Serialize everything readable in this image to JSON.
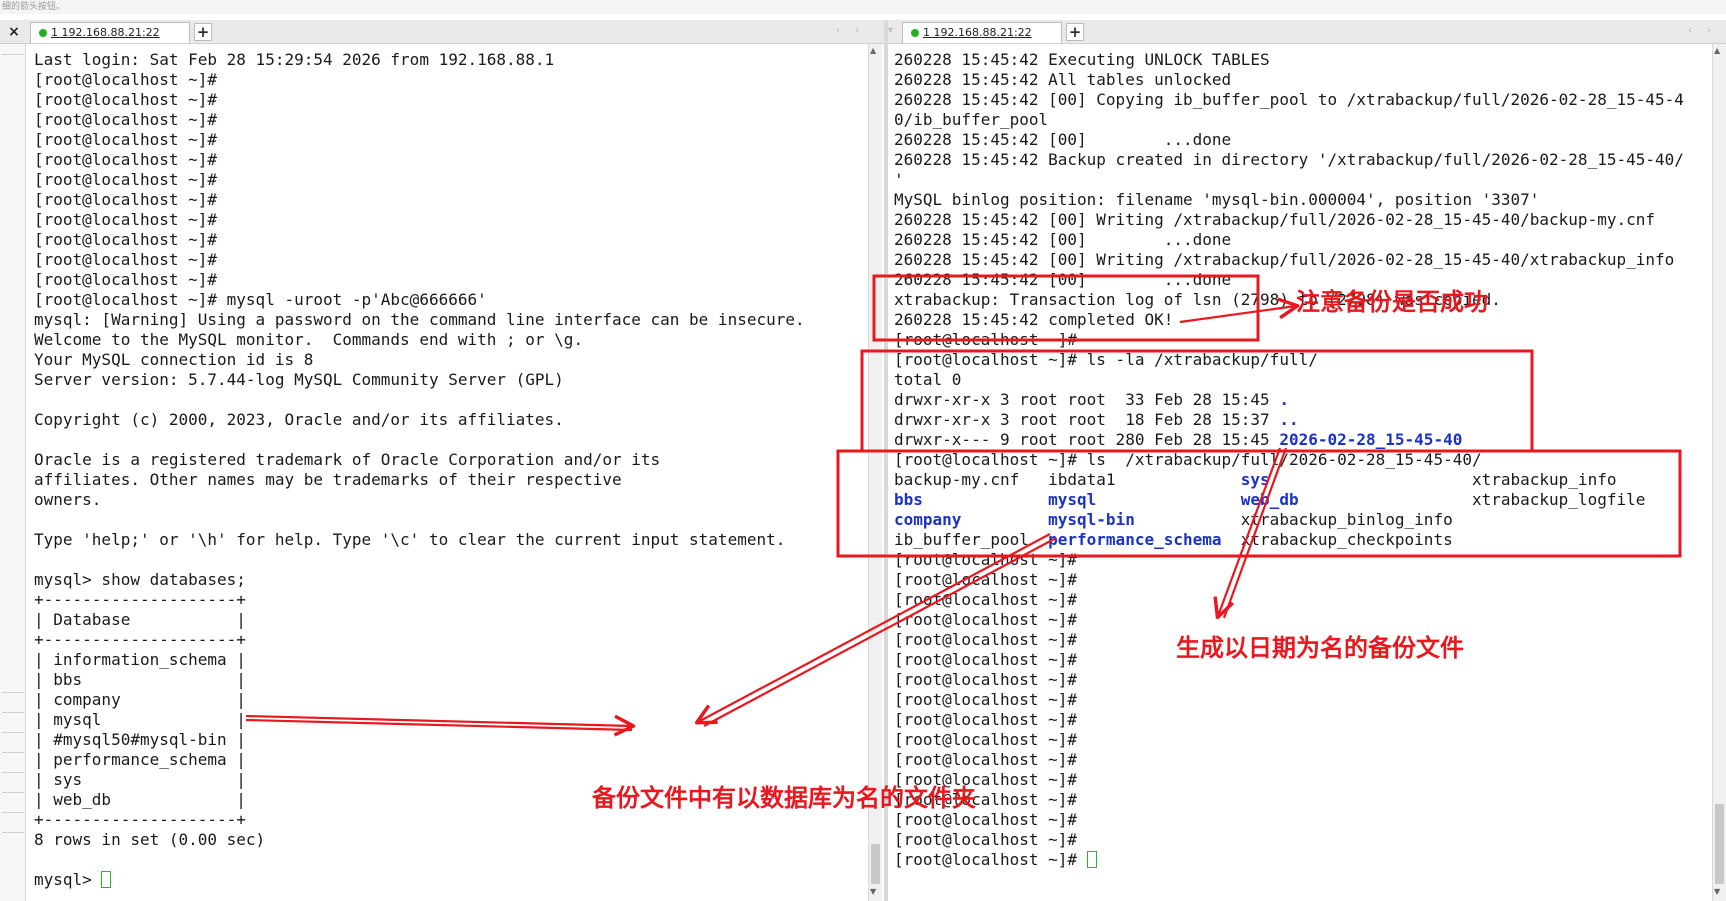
{
  "top_hint": "细的箭头按钮。",
  "left_pane": {
    "tab_label": "1 192.168.88.21:22",
    "lines": [
      "Last login: Sat Feb 28 15:29:54 2026 from 192.168.88.1",
      "[root@localhost ~]#",
      "[root@localhost ~]#",
      "[root@localhost ~]#",
      "[root@localhost ~]#",
      "[root@localhost ~]#",
      "[root@localhost ~]#",
      "[root@localhost ~]#",
      "[root@localhost ~]#",
      "[root@localhost ~]#",
      "[root@localhost ~]#",
      "[root@localhost ~]#",
      "[root@localhost ~]# mysql -uroot -p'Abc@666666'",
      "mysql: [Warning] Using a password on the command line interface can be insecure.",
      "Welcome to the MySQL monitor.  Commands end with ; or \\g.",
      "Your MySQL connection id is 8",
      "Server version: 5.7.44-log MySQL Community Server (GPL)",
      "",
      "Copyright (c) 2000, 2023, Oracle and/or its affiliates.",
      "",
      "Oracle is a registered trademark of Oracle Corporation and/or its",
      "affiliates. Other names may be trademarks of their respective",
      "owners.",
      "",
      "Type 'help;' or '\\h' for help. Type '\\c' to clear the current input statement.",
      "",
      "mysql> show databases;",
      "+--------------------+",
      "| Database           |",
      "+--------------------+",
      "| information_schema |",
      "| bbs                |",
      "| company            |",
      "| mysql              |",
      "| #mysql50#mysql-bin |",
      "| performance_schema |",
      "| sys                |",
      "| web_db             |",
      "+--------------------+",
      "8 rows in set (0.00 sec)",
      ""
    ],
    "prompt": "mysql> "
  },
  "right_pane": {
    "tab_label": "1 192.168.88.21:22",
    "lines_top": [
      "260228 15:45:42 Executing UNLOCK TABLES",
      "260228 15:45:42 All tables unlocked",
      "260228 15:45:42 [00] Copying ib_buffer_pool to /xtrabackup/full/2026-02-28_15-45-4",
      "0/ib_buffer_pool",
      "260228 15:45:42 [00]        ...done",
      "260228 15:45:42 Backup created in directory '/xtrabackup/full/2026-02-28_15-45-40/",
      "'",
      "MySQL binlog position: filename 'mysql-bin.000004', position '3307'",
      "260228 15:45:42 [00] Writing /xtrabackup/full/2026-02-28_15-45-40/backup-my.cnf",
      "260228 15:45:42 [00]        ...done",
      "260228 15:45:42 [00] Writing /xtrabackup/full/2026-02-28_15-45-40/xtrabackup_info",
      "260228 15:45:42 [00]        ...done",
      "xtrabackup: Transaction log of lsn (2798) to (2798) was copied.",
      "260228 15:45:42 completed OK!",
      "[root@localhost ~]#",
      "[root@localhost ~]# ls -la /xtrabackup/full/",
      "total 0",
      "drwxr-xr-x 3 root root  33 Feb 28 15:45 ",
      "drwxr-xr-x 3 root root  18 Feb 28 15:37 ",
      "drwxr-x--- 9 root root 280 Feb 28 15:45 ",
      "[root@localhost ~]# ls  /xtrabackup/full/2026-02-28_15-45-40/"
    ],
    "ls_la_names": [
      ".",
      "..",
      "2026-02-28_15-45-40"
    ],
    "ls_cols": [
      [
        "backup-my.cnf",
        "ibdata1",
        "sys",
        "xtrabackup_info"
      ],
      [
        "bbs",
        "mysql",
        "web_db",
        "xtrabackup_logfile"
      ],
      [
        "company",
        "mysql-bin",
        "xtrabackup_binlog_info",
        ""
      ],
      [
        "ib_buffer_pool",
        "performance_schema",
        "xtrabackup_checkpoints",
        ""
      ]
    ],
    "ls_bold": [
      "sys",
      "bbs",
      "mysql",
      "web_db",
      "company",
      "mysql-bin",
      "performance_schema"
    ],
    "prompt_line": "[root@localhost ~]#",
    "prompt_count": 16
  },
  "annotations": {
    "check_success": "注意备份是否成功",
    "date_named_file": "生成以日期为名的备份文件",
    "db_folders": "备份文件中有以数据库为名的文件夹"
  },
  "colors": {
    "annotation_red": "#e8181f",
    "dir_blue": "#1a32c8",
    "cursor_green": "#22bb22",
    "tab_dot_green": "#1fb11f"
  },
  "icons": {
    "close": "×",
    "add_tab": "+",
    "tab_scroll": "‹ ›"
  }
}
